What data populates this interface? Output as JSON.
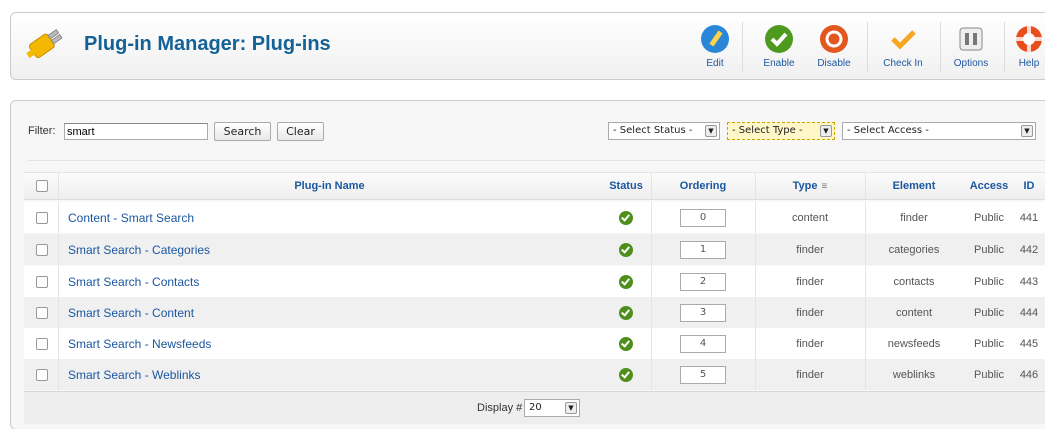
{
  "header": {
    "title": "Plug-in Manager: Plug-ins",
    "toolbar": [
      {
        "label": "Edit",
        "icon": "edit-icon",
        "color": "#2a87d8"
      },
      {
        "label": "Enable",
        "icon": "enable-icon",
        "color": "#4e9a1e"
      },
      {
        "label": "Disable",
        "icon": "disable-icon",
        "color": "#e2561f"
      },
      {
        "label": "Check In",
        "icon": "checkin-icon",
        "color": "#f5a623"
      },
      {
        "label": "Options",
        "icon": "options-icon",
        "color": "#888888"
      },
      {
        "label": "Help",
        "icon": "help-icon",
        "color": "#e84d1c"
      }
    ]
  },
  "filter": {
    "label": "Filter:",
    "value": "smart",
    "search_label": "Search",
    "clear_label": "Clear"
  },
  "selects": {
    "status": "- Select Status -",
    "type": "- Select Type -",
    "access": "- Select Access -"
  },
  "table": {
    "columns": [
      "Plug-in Name",
      "Status",
      "Ordering",
      "Type",
      "Element",
      "Access",
      "ID"
    ],
    "rows": [
      {
        "name": "Content - Smart Search",
        "ordering": "0",
        "type": "content",
        "element": "finder",
        "access": "Public",
        "id": "441"
      },
      {
        "name": "Smart Search - Categories",
        "ordering": "1",
        "type": "finder",
        "element": "categories",
        "access": "Public",
        "id": "442"
      },
      {
        "name": "Smart Search - Contacts",
        "ordering": "2",
        "type": "finder",
        "element": "contacts",
        "access": "Public",
        "id": "443"
      },
      {
        "name": "Smart Search - Content",
        "ordering": "3",
        "type": "finder",
        "element": "content",
        "access": "Public",
        "id": "444"
      },
      {
        "name": "Smart Search - Newsfeeds",
        "ordering": "4",
        "type": "finder",
        "element": "newsfeeds",
        "access": "Public",
        "id": "445"
      },
      {
        "name": "Smart Search - Weblinks",
        "ordering": "5",
        "type": "finder",
        "element": "weblinks",
        "access": "Public",
        "id": "446"
      }
    ]
  },
  "footer": {
    "display_label": "Display #",
    "display_value": "20"
  }
}
